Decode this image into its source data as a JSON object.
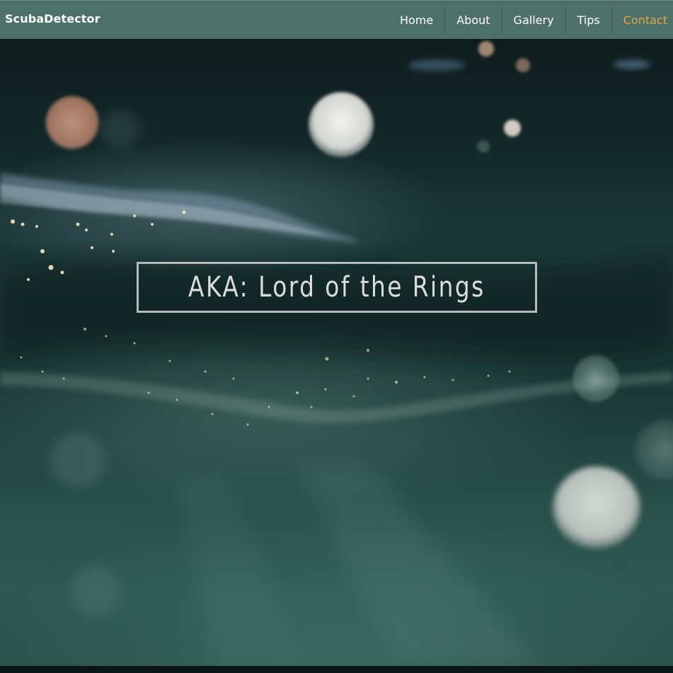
{
  "navbar": {
    "brand": "ScubaDetector",
    "items": [
      {
        "label": "Home",
        "active": false
      },
      {
        "label": "About",
        "active": false
      },
      {
        "label": "Gallery",
        "active": false
      },
      {
        "label": "Tips",
        "active": false
      },
      {
        "label": "Contact",
        "active": true
      }
    ]
  },
  "hero": {
    "title": "AKA: Lord of the Rings"
  },
  "colors": {
    "navbar_bg": "#4d7069",
    "active_link": "#e3a945",
    "text": "#ffffff",
    "title_border": "#b3bcbb"
  }
}
